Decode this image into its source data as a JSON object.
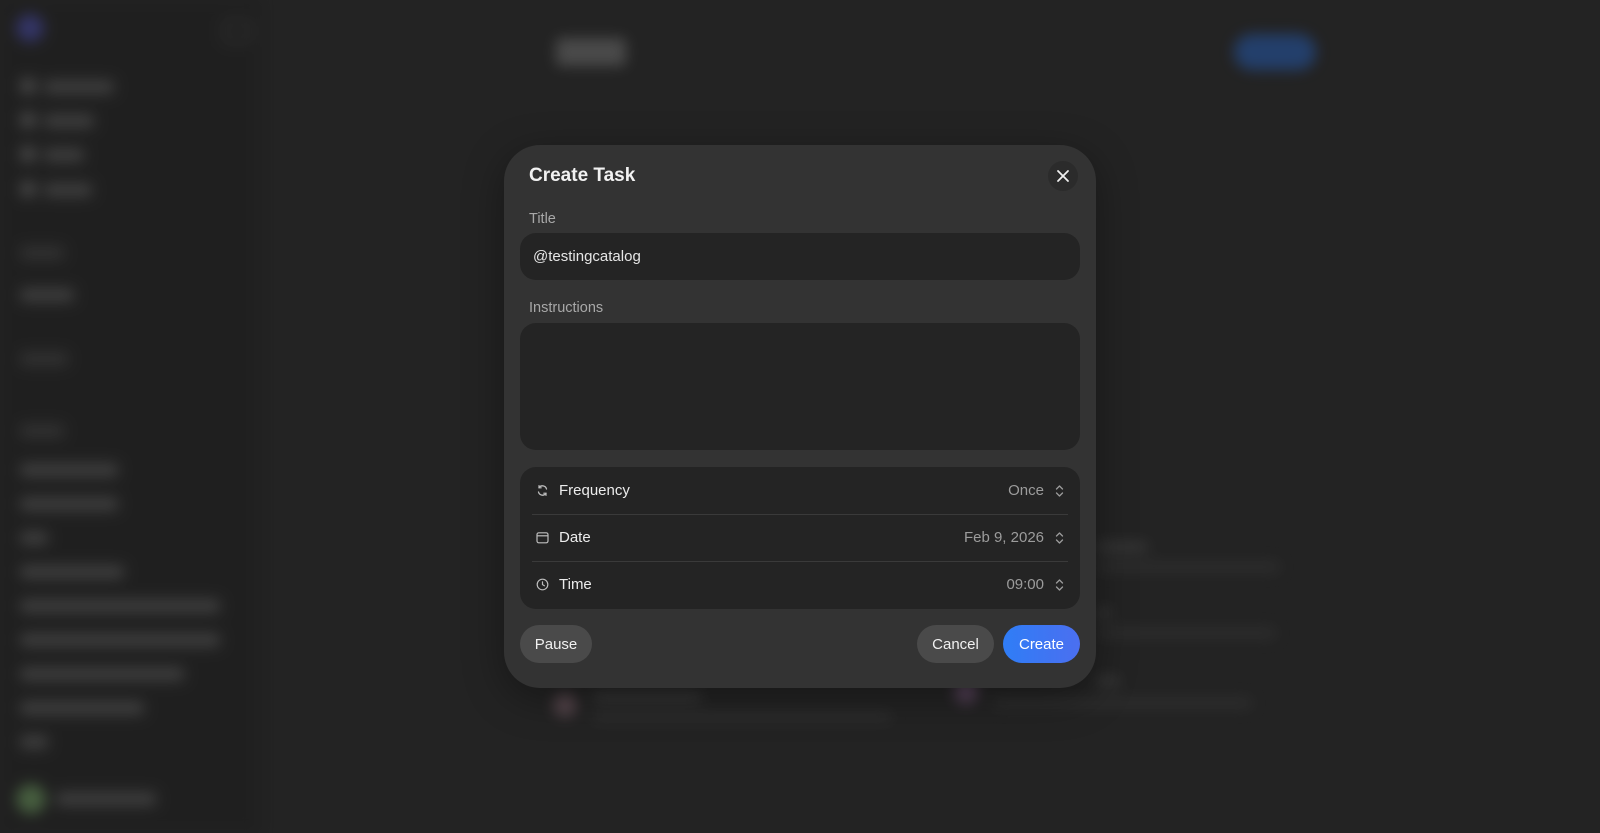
{
  "modal": {
    "title": "Create Task",
    "close_icon": "close-icon",
    "title_field": {
      "label": "Title",
      "value": "@testingcatalog",
      "placeholder": ""
    },
    "instructions_field": {
      "label": "Instructions",
      "value": ""
    },
    "settings": [
      {
        "icon": "repeat-icon",
        "label": "Frequency",
        "value": "Once"
      },
      {
        "icon": "calendar-icon",
        "label": "Date",
        "value": "Feb 9, 2026"
      },
      {
        "icon": "clock-icon",
        "label": "Time",
        "value": "09:00"
      }
    ],
    "buttons": {
      "pause": "Pause",
      "cancel": "Cancel",
      "create": "Create"
    }
  },
  "colors": {
    "accent": "#2f7df6",
    "modal_bg": "#333333",
    "field_bg": "#242424",
    "page_bg": "#2b2b2b"
  }
}
